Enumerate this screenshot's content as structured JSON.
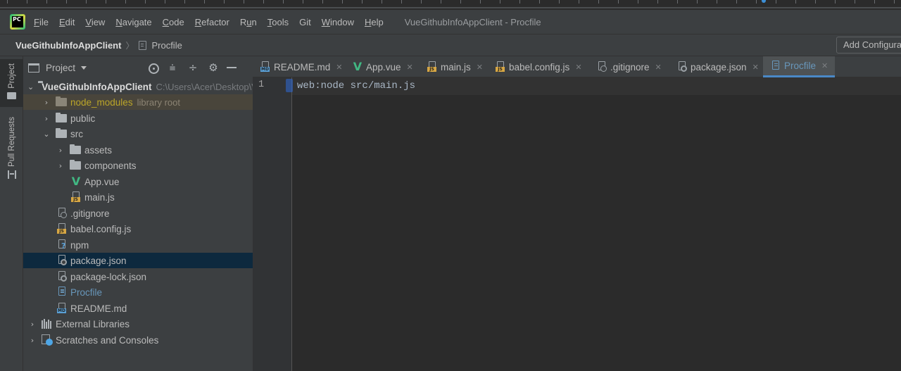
{
  "menubar": {
    "items": [
      {
        "mnemonic": "F",
        "rest": "ile"
      },
      {
        "mnemonic": "E",
        "rest": "dit"
      },
      {
        "mnemonic": "V",
        "rest": "iew"
      },
      {
        "mnemonic": "N",
        "rest": "avigate"
      },
      {
        "mnemonic": "C",
        "rest": "ode"
      },
      {
        "mnemonic": "R",
        "rest": "efactor"
      },
      {
        "pre": "R",
        "mnemonic": "u",
        "rest": "n"
      },
      {
        "mnemonic": "T",
        "rest": "ools"
      },
      {
        "pre": "Git",
        "mnemonic": "",
        "rest": ""
      },
      {
        "mnemonic": "W",
        "rest": "indow"
      },
      {
        "mnemonic": "H",
        "rest": "elp"
      }
    ],
    "window_title": "VueGithubInfoAppClient - Procfile"
  },
  "navbar": {
    "project": "VueGithubInfoAppClient",
    "file": "Procfile",
    "add_configuration": "Add Configuration..."
  },
  "toolstrip": {
    "project": "Project",
    "pull_requests": "Pull Requests"
  },
  "project_panel": {
    "title": "Project"
  },
  "tree": {
    "root": {
      "name": "VueGithubInfoAppClient",
      "path": "C:\\Users\\Acer\\Desktop\\VueGithubInfoAppClient"
    },
    "node_modules": {
      "name": "node_modules",
      "hint": "library root"
    },
    "public": "public",
    "src": "src",
    "assets": "assets",
    "components": "components",
    "app_vue": "App.vue",
    "main_js": "main.js",
    "gitignore": ".gitignore",
    "babel": "babel.config.js",
    "npm": "npm",
    "package_json": "package.json",
    "package_lock": "package-lock.json",
    "procfile": "Procfile",
    "readme": "README.md",
    "external": "External Libraries",
    "scratches": "Scratches and Consoles"
  },
  "tabs": [
    {
      "label": "README.md",
      "icon": "md"
    },
    {
      "label": "App.vue",
      "icon": "vue"
    },
    {
      "label": "main.js",
      "icon": "js"
    },
    {
      "label": "babel.config.js",
      "icon": "js"
    },
    {
      "label": ".gitignore",
      "icon": "ignore"
    },
    {
      "label": "package.json",
      "icon": "json"
    },
    {
      "label": "Procfile",
      "icon": "text",
      "active": true
    }
  ],
  "editor": {
    "line_number": "1",
    "code": "web:node src/main.js"
  },
  "colors": {
    "background": "#2b2b2b",
    "panel": "#3c3f41",
    "selection": "#0d293e",
    "accent": "#4a88c7",
    "vue_green": "#41b883",
    "excluded_folder": "#bba529"
  }
}
